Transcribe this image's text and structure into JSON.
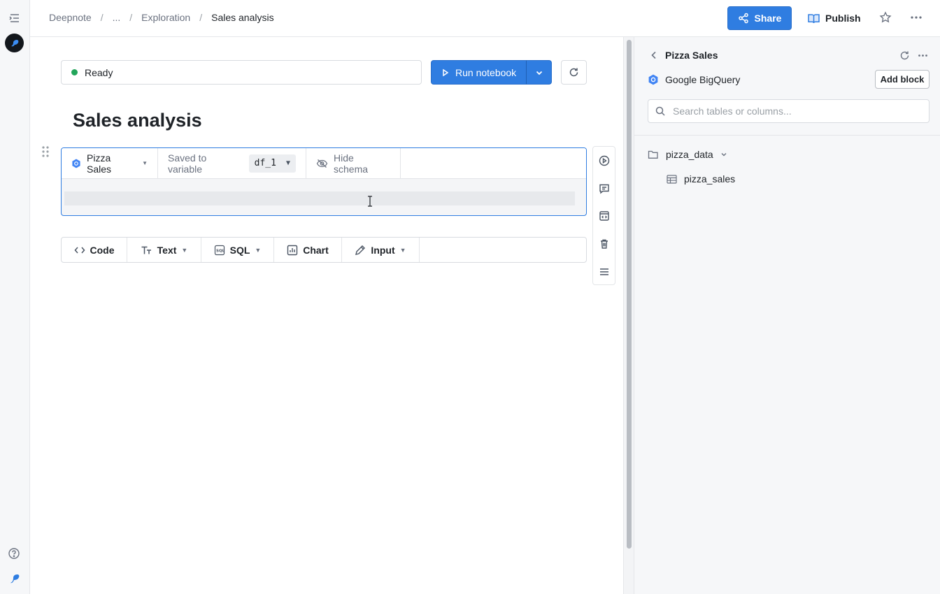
{
  "topbar": {
    "breadcrumb": [
      "Deepnote",
      "...",
      "Exploration"
    ],
    "current": "Sales analysis",
    "share_label": "Share",
    "publish_label": "Publish"
  },
  "notebook": {
    "status": "Ready",
    "run_label": "Run notebook",
    "title": "Sales analysis"
  },
  "sql_block": {
    "source_label": "Pizza Sales",
    "saved_label": "Saved to variable",
    "variable": "df_1",
    "hide_schema_label": "Hide schema"
  },
  "add_bar": {
    "code": "Code",
    "text": "Text",
    "sql": "SQL",
    "chart": "Chart",
    "input": "Input"
  },
  "panel": {
    "title": "Pizza Sales",
    "integration": "Google BigQuery",
    "add_block": "Add block",
    "search_placeholder": "Search tables or columns...",
    "folder": "pizza_data",
    "table": "pizza_sales"
  },
  "colors": {
    "accent": "#2f7de1",
    "status_ready": "#22a55a",
    "bigquery": "#4285f4"
  }
}
